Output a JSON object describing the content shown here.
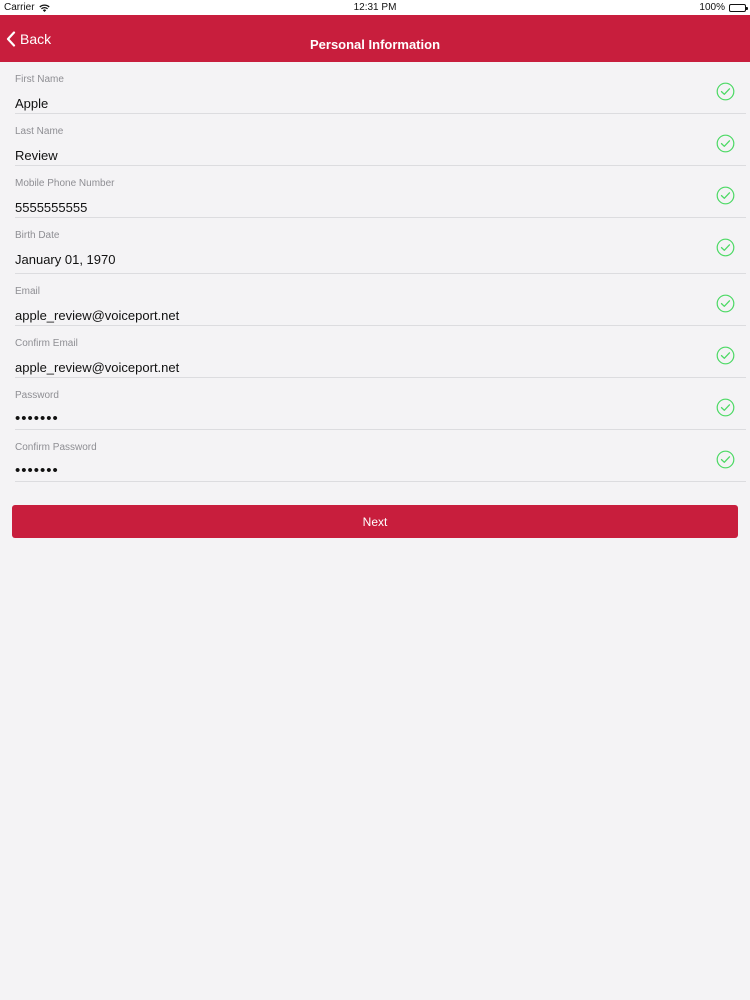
{
  "status_bar": {
    "carrier": "Carrier",
    "time": "12:31 PM",
    "battery": "100%",
    "wifi_icon": "wifi-icon",
    "battery_icon": "battery-icon"
  },
  "nav": {
    "back_label": "Back",
    "title": "Personal Information",
    "back_icon": "chevron-left-icon"
  },
  "fields": [
    {
      "label": "First Name",
      "value": "Apple",
      "valid": true
    },
    {
      "label": "Last Name",
      "value": "Review",
      "valid": true
    },
    {
      "label": "Mobile Phone Number",
      "value": "5555555555",
      "valid": true
    },
    {
      "label": "Birth Date",
      "value": "January 01, 1970",
      "valid": true
    },
    {
      "label": "Email",
      "value": "apple_review@voiceport.net",
      "valid": true
    },
    {
      "label": "Confirm Email",
      "value": "apple_review@voiceport.net",
      "valid": true
    },
    {
      "label": "Password",
      "value": "•••••••",
      "valid": true
    },
    {
      "label": "Confirm Password",
      "value": "•••••••",
      "valid": true
    }
  ],
  "next_button": {
    "label": "Next"
  },
  "colors": {
    "accent": "#c81e3d",
    "check_green": "#4cd964",
    "background": "#f4f3f5"
  }
}
